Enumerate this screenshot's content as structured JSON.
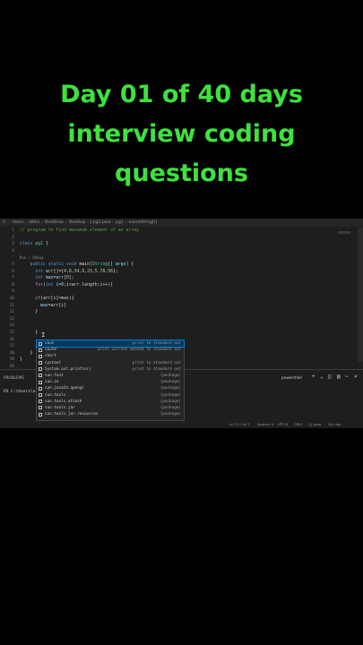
{
  "headline": {
    "line1": "Day 01 of 40 days",
    "line2": "interview coding",
    "line3": "questions"
  },
  "breadcrumb": [
    "C:",
    "Users",
    "abhis",
    "OneDrive",
    "Desktop",
    "J pg1.java",
    "pg1",
    "main(String[])"
  ],
  "code_lines": [
    {
      "n": "1",
      "parts": [
        [
          "cmt",
          "// program to find maximum element of an array"
        ]
      ]
    },
    {
      "n": "2",
      "parts": []
    },
    {
      "n": "3",
      "parts": [
        [
          "kw",
          "class "
        ],
        [
          "ty",
          "pg1"
        ],
        [
          "",
          " {"
        ]
      ]
    },
    {
      "n": "4",
      "parts": []
    },
    {
      "n": "",
      "parts": [
        [
          "lens",
          "Run | Debug"
        ]
      ]
    },
    {
      "n": "5",
      "parts": [
        [
          "kw",
          "    public static void "
        ],
        [
          "fn",
          "main"
        ],
        [
          "",
          "("
        ],
        [
          "ty",
          "String"
        ],
        [
          "",
          "[] "
        ],
        [
          "var",
          "args"
        ],
        [
          "",
          ") {"
        ]
      ]
    },
    {
      "n": "6",
      "parts": [
        [
          "kw",
          "      int "
        ],
        [
          "var",
          "arr"
        ],
        [
          "",
          "[]={"
        ],
        [
          "num",
          "4,8,34,6,23,5,78,56"
        ],
        [
          "",
          "};"
        ]
      ]
    },
    {
      "n": "7",
      "parts": [
        [
          "kw",
          "      int "
        ],
        [
          "var",
          "max"
        ],
        [
          "",
          "="
        ],
        [
          "var",
          "arr"
        ],
        [
          "",
          "["
        ],
        [
          "num",
          "0"
        ],
        [
          "",
          "];"
        ]
      ]
    },
    {
      "n": "8",
      "parts": [
        [
          "ctl",
          "      for"
        ],
        [
          "",
          "("
        ],
        [
          "kw",
          "int "
        ],
        [
          "var",
          "i"
        ],
        [
          "",
          "="
        ],
        [
          "num",
          "0"
        ],
        [
          "",
          ";i<arr.length;i++){"
        ]
      ]
    },
    {
      "n": "9",
      "parts": []
    },
    {
      "n": "10",
      "parts": [
        [
          "ctl",
          "      if"
        ],
        [
          "",
          "(arr[i]>max){"
        ]
      ]
    },
    {
      "n": "11",
      "parts": [
        [
          "var",
          "        max"
        ],
        [
          "",
          "=arr[i]"
        ]
      ]
    },
    {
      "n": "12",
      "parts": [
        [
          "",
          "      }"
        ]
      ]
    },
    {
      "n": "13",
      "parts": []
    },
    {
      "n": "14",
      "parts": []
    },
    {
      "n": "15",
      "parts": [
        [
          "",
          "      }"
        ]
      ]
    },
    {
      "n": "16",
      "parts": [
        [
          "",
          "      "
        ]
      ]
    },
    {
      "n": "17",
      "parts": [
        [
          "",
          "      so"
        ]
      ]
    },
    {
      "n": "18",
      "parts": [
        [
          "",
          "    }"
        ]
      ]
    },
    {
      "n": "19",
      "parts": [
        [
          "",
          "}"
        ]
      ]
    },
    {
      "n": "20",
      "parts": []
    }
  ],
  "suggestions": [
    {
      "label": "sout",
      "detail": "print to standard out",
      "selected": true
    },
    {
      "label": "soutm",
      "detail": "print current method to standard out",
      "selected": false
    },
    {
      "label": "short",
      "detail": "",
      "selected": false
    },
    {
      "label": "systout",
      "detail": "print to standard out",
      "selected": false
    },
    {
      "label": "System.out.println()",
      "detail": "print to standard out",
      "selected": false
    },
    {
      "label": "sun.font",
      "detail": "(package)",
      "selected": false
    },
    {
      "label": "sun.io",
      "detail": "(package)",
      "selected": false
    },
    {
      "label": "sun.java2d.opengl",
      "detail": "(package)",
      "selected": false
    },
    {
      "label": "sun.tools",
      "detail": "(package)",
      "selected": false
    },
    {
      "label": "sun.tools.attach",
      "detail": "(package)",
      "selected": false
    },
    {
      "label": "sun.tools.jar",
      "detail": "(package)",
      "selected": false
    },
    {
      "label": "sun.tools.jar.resources",
      "detail": "(package)",
      "selected": false
    }
  ],
  "panel": {
    "tab": "PROBLEMS",
    "terminal": "powershell",
    "prompt": "PS C:\\Users\\a"
  },
  "status": {
    "position": "Ln 17, Col 7",
    "spaces": "Spaces: 4",
    "encoding": "UTF-8",
    "eol": "CRLF",
    "language": "{} Java",
    "live": "Go Live"
  }
}
